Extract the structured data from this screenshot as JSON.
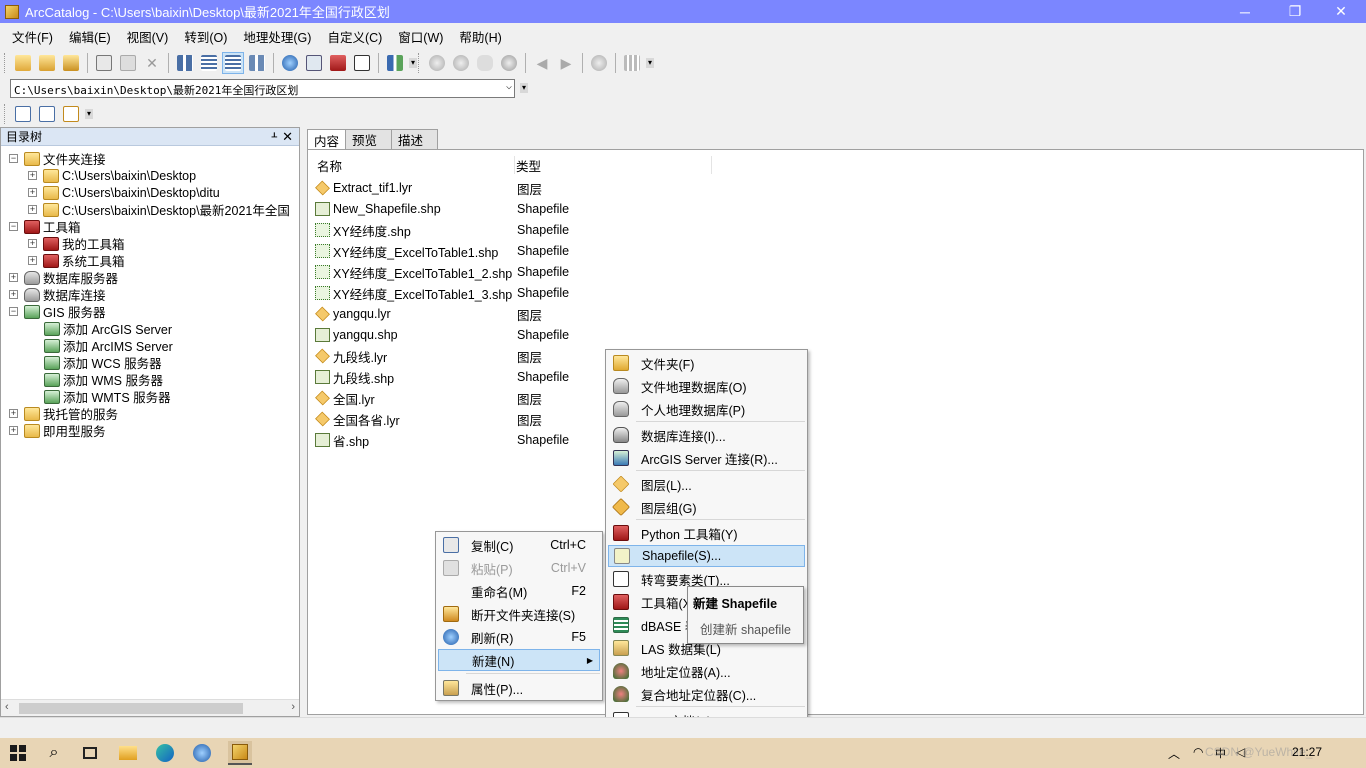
{
  "window": {
    "title": "ArcCatalog - C:\\Users\\baixin\\Desktop\\最新2021年全国行政区划"
  },
  "window_controls": {
    "minimize": "─",
    "restore": "❐",
    "close": "✕"
  },
  "menubar": [
    "文件(F)",
    "编辑(E)",
    "视图(V)",
    "转到(O)",
    "地理处理(G)",
    "自定义(C)",
    "窗口(W)",
    "帮助(H)"
  ],
  "address": {
    "value": "C:\\Users\\baixin\\Desktop\\最新2021年全国行政区划"
  },
  "left_panel": {
    "title": "目录树",
    "pin": "ᚆ",
    "close": "✕",
    "expanders": {
      "collapsed": "+",
      "expanded": "−"
    },
    "tree": [
      {
        "label": "文件夹连接",
        "icon": "folder-connections-icon",
        "exp": "−"
      },
      {
        "label": "C:\\Users\\baixin\\Desktop",
        "icon": "folder-icon",
        "exp": "+"
      },
      {
        "label": "C:\\Users\\baixin\\Desktop\\ditu",
        "icon": "folder-icon",
        "exp": "+"
      },
      {
        "label": "C:\\Users\\baixin\\Desktop\\最新2021年全国",
        "icon": "folder-icon",
        "exp": "+"
      },
      {
        "label": "工具箱",
        "icon": "toolbox-icon",
        "exp": "−"
      },
      {
        "label": "我的工具箱",
        "icon": "toolbox-icon",
        "exp": "+"
      },
      {
        "label": "系统工具箱",
        "icon": "toolbox-icon",
        "exp": "+"
      },
      {
        "label": "数据库服务器",
        "icon": "database-server-icon",
        "exp": "+"
      },
      {
        "label": "数据库连接",
        "icon": "database-connection-icon",
        "exp": "+"
      },
      {
        "label": "GIS 服务器",
        "icon": "gis-server-icon",
        "exp": "−"
      },
      {
        "label": "添加 ArcGIS Server",
        "icon": "add-server-icon"
      },
      {
        "label": "添加 ArcIMS Server",
        "icon": "add-server-icon"
      },
      {
        "label": "添加 WCS 服务器",
        "icon": "add-server-icon"
      },
      {
        "label": "添加 WMS 服务器",
        "icon": "add-server-icon"
      },
      {
        "label": "添加 WMTS 服务器",
        "icon": "add-server-icon"
      },
      {
        "label": "我托管的服务",
        "icon": "hosted-services-icon",
        "exp": "+"
      },
      {
        "label": "即用型服务",
        "icon": "ready-services-icon",
        "exp": "+"
      }
    ],
    "scroll": {
      "left": "‹",
      "right": "›"
    }
  },
  "tabs": [
    "内容",
    "预览",
    "描述"
  ],
  "columns": {
    "name": "名称",
    "type": "类型"
  },
  "files": [
    {
      "name": "Extract_tif1.lyr",
      "type": "图层",
      "icon": "lyr"
    },
    {
      "name": "New_Shapefile.shp",
      "type": "Shapefile",
      "icon": "shp"
    },
    {
      "name": "XY经纬度.shp",
      "type": "Shapefile",
      "icon": "pt"
    },
    {
      "name": "XY经纬度_ExcelToTable1.shp",
      "type": "Shapefile",
      "icon": "pt"
    },
    {
      "name": "XY经纬度_ExcelToTable1_2.shp",
      "type": "Shapefile",
      "icon": "pt"
    },
    {
      "name": "XY经纬度_ExcelToTable1_3.shp",
      "type": "Shapefile",
      "icon": "pt"
    },
    {
      "name": "yangqu.lyr",
      "type": "图层",
      "icon": "lyr"
    },
    {
      "name": "yangqu.shp",
      "type": "Shapefile",
      "icon": "shp"
    },
    {
      "name": "九段线.lyr",
      "type": "图层",
      "icon": "lyr"
    },
    {
      "name": "九段线.shp",
      "type": "Shapefile",
      "icon": "line"
    },
    {
      "name": "全国.lyr",
      "type": "图层",
      "icon": "lyr"
    },
    {
      "name": "全国各省.lyr",
      "type": "图层",
      "icon": "lyr"
    },
    {
      "name": "省.shp",
      "type": "Shapefile",
      "icon": "shp"
    }
  ],
  "context_menu": [
    {
      "label": "复制(C)",
      "shortcut": "Ctrl+C",
      "icon": "copy-icon"
    },
    {
      "label": "粘贴(P)",
      "shortcut": "Ctrl+V",
      "icon": "paste-icon",
      "disabled": true
    },
    {
      "label": "重命名(M)",
      "shortcut": "F2"
    },
    {
      "label": "断开文件夹连接(S)",
      "icon": "disconnect-folder-icon"
    },
    {
      "label": "刷新(R)",
      "shortcut": "F5",
      "icon": "refresh-icon"
    },
    {
      "label": "新建(N)",
      "submenu_arrow": "▶",
      "highlighted": true
    },
    {
      "label": "属性(P)...",
      "icon": "properties-icon"
    }
  ],
  "submenu": [
    {
      "label": "文件夹(F)",
      "icon": "folder"
    },
    {
      "label": "文件地理数据库(O)",
      "icon": "gdb"
    },
    {
      "label": "个人地理数据库(P)",
      "icon": "gdb"
    },
    {
      "label": "数据库连接(I)...",
      "icon": "dbconn"
    },
    {
      "label": "ArcGIS Server 连接(R)...",
      "icon": "server"
    },
    {
      "label": "图层(L)...",
      "icon": "layer"
    },
    {
      "label": "图层组(G)",
      "icon": "layergroup"
    },
    {
      "label": "Python 工具箱(Y)",
      "icon": "pytoolbox"
    },
    {
      "label": "Shapefile(S)...",
      "icon": "shapefile",
      "highlighted": true
    },
    {
      "label": "转弯要素类(T)...",
      "icon": "turn"
    },
    {
      "label": "工具箱(X)",
      "icon": "toolbox"
    },
    {
      "label": "dBASE 表(D)",
      "icon": "dbase"
    },
    {
      "label": "LAS 数据集(L)",
      "icon": "las"
    },
    {
      "label": "地址定位器(A)...",
      "icon": "locator"
    },
    {
      "label": "复合地址定位器(C)...",
      "icon": "locator"
    },
    {
      "label": "XML 文档(X)",
      "icon": "xml"
    }
  ],
  "tooltip": {
    "title": "新建 Shapefile",
    "description": "创建新 shapefile"
  },
  "taskbar": {
    "clock": "21:27",
    "ime": "中",
    "watermark": "CSDN @YueWhite_"
  }
}
